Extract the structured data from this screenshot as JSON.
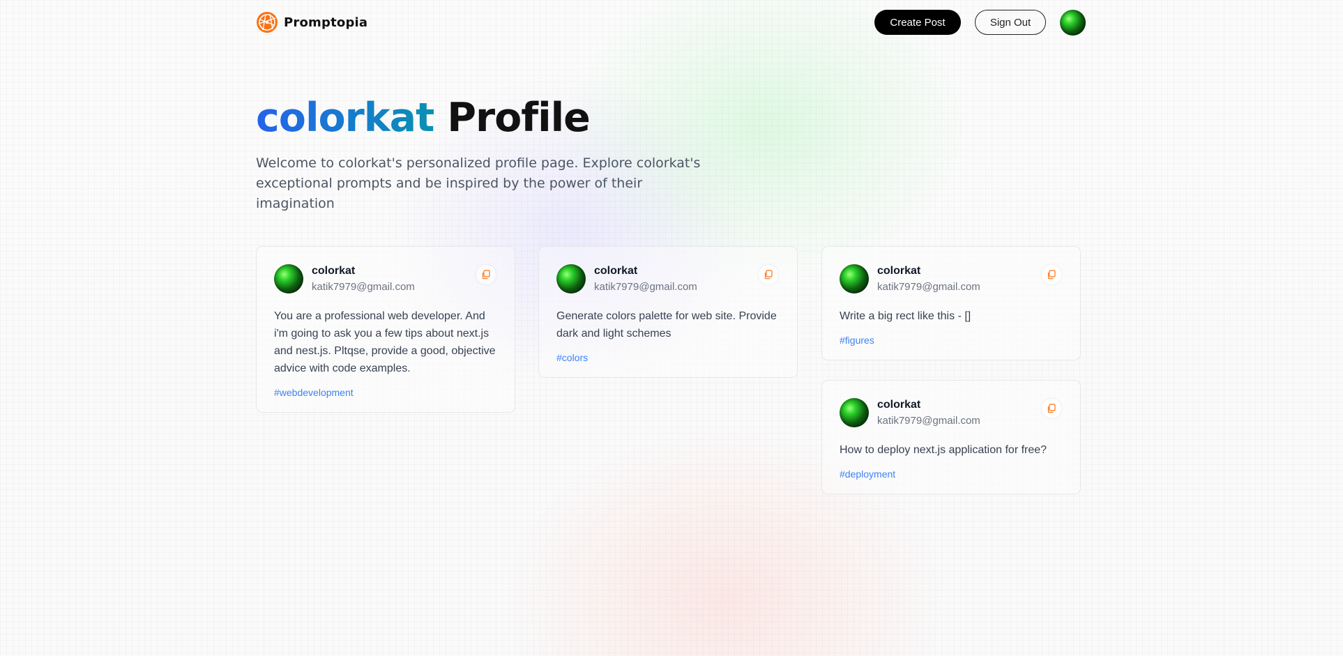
{
  "nav": {
    "brand": "Promptopia",
    "create_label": "Create Post",
    "signout_label": "Sign Out"
  },
  "header": {
    "username": "colorkat",
    "title_suffix": "Profile",
    "description": "Welcome to colorkat's personalized profile page. Explore colorkat's exceptional prompts and be inspired by the power of their imagination"
  },
  "posts": [
    {
      "name": "colorkat",
      "email": "katik7979@gmail.com",
      "prompt": "You are a professional web developer. And i'm going to ask you a few tips about next.js and nest.js. Pltqse, provide a good, objective advice with code examples.",
      "tag": "#webdevelopment"
    },
    {
      "name": "colorkat",
      "email": "katik7979@gmail.com",
      "prompt": "Generate colors palette for web site. Provide dark and light schemes",
      "tag": "#colors"
    },
    {
      "name": "colorkat",
      "email": "katik7979@gmail.com",
      "prompt": "Write a big rect like this - []",
      "tag": "#figures"
    },
    {
      "name": "colorkat",
      "email": "katik7979@gmail.com",
      "prompt": "How to deploy next.js application for free?",
      "tag": "#deployment"
    }
  ],
  "icons": {
    "logo": "promptopia-logo-icon",
    "copy": "copy-icon"
  },
  "colors": {
    "accent_orange": "#f97316",
    "tag_blue": "#3b82f6",
    "title_gradient_start": "#2563eb",
    "title_gradient_end": "#0891b2"
  }
}
